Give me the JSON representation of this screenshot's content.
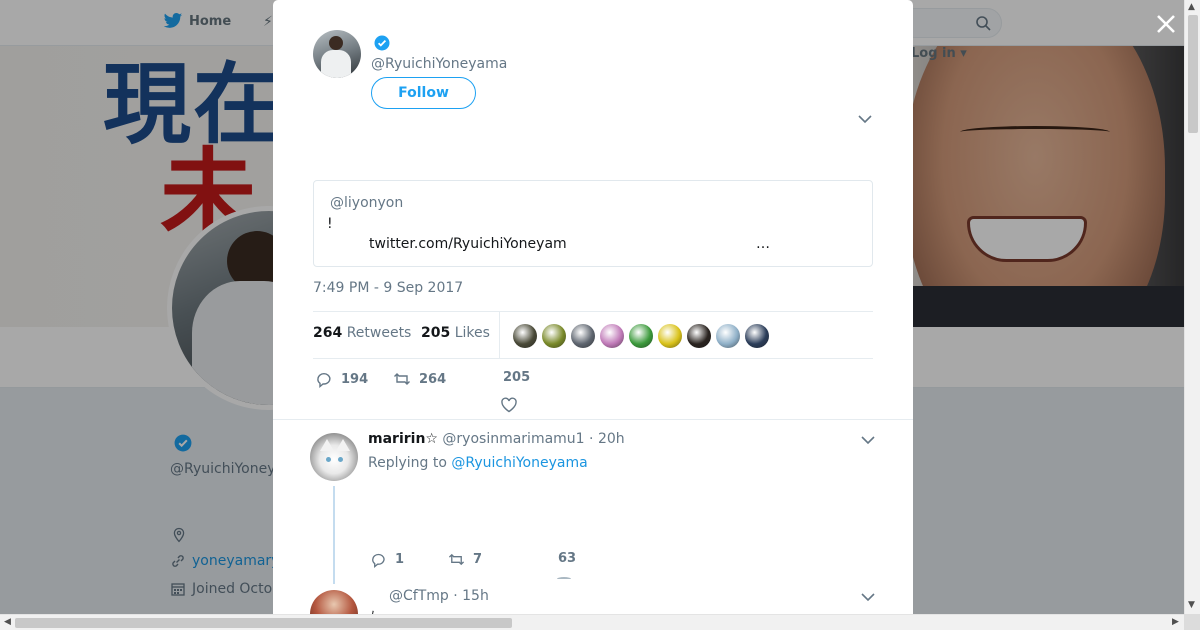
{
  "background": {
    "nav": {
      "home_label": "Home",
      "login_label": "Log in"
    },
    "banner": {
      "kanji_top": "現在",
      "kanji_bottom": "未"
    },
    "profile": {
      "name": "",
      "handle": "@RyuichiYoney",
      "link": "yoneyamary",
      "joined": "Joined Octo"
    }
  },
  "tweet": {
    "handle": "@RyuichiYoneyama",
    "follow_label": "Follow",
    "text": "",
    "quote": {
      "handle": "@liyonyon",
      "line1": "!",
      "link": "twitter.com/RyuichiYoneyam",
      "ellipsis": "…"
    },
    "timestamp": "7:49 PM - 9 Sep 2017",
    "retweets": {
      "count": "264",
      "label": "Retweets"
    },
    "likes": {
      "count": "205",
      "label": "Likes"
    },
    "liker_colors": [
      "#4a4a38",
      "#7a8a2a",
      "#5f6670",
      "#c07ab8",
      "#3c9a3c",
      "#d9c21a",
      "#2a2420",
      "#8fb0c8",
      "#2c3e5a"
    ],
    "actions": {
      "replies": "194",
      "retweets": "264",
      "likes": "205"
    }
  },
  "replies": [
    {
      "name": "maririn☆",
      "handle": "@ryosinmarimamu1",
      "time": "· 20h",
      "replying_prefix": "Replying to",
      "replying_to": "@RyuichiYoneyama",
      "actions": {
        "replies": "1",
        "retweets": "7",
        "likes": "63"
      }
    },
    {
      "name": "",
      "handle": "@CfTmp",
      "time": "· 15h",
      "text": "ﾉ"
    }
  ],
  "colors": {
    "accent": "#1da1f2",
    "link": "#1b95e0",
    "muted": "#657786"
  }
}
